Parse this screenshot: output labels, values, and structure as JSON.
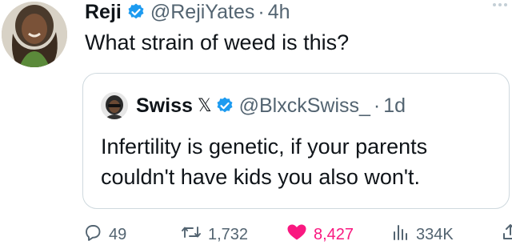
{
  "tweet": {
    "display_name": "Reji",
    "handle": "@RejiYates",
    "separator": "·",
    "time": "4h",
    "text": "What strain of weed is this?"
  },
  "quoted": {
    "display_name": "Swiss",
    "badge": "𝕏",
    "handle": "@BlxckSwiss_",
    "separator": "·",
    "time": "1d",
    "text_line1": "Infertility is genetic, if your parents",
    "text_line2": "couldn't have kids you also won't."
  },
  "actions": {
    "replies": "49",
    "retweets": "1,732",
    "likes": "8,427",
    "views": "334K"
  },
  "colors": {
    "verified": "#1d9bf0",
    "like": "#f91880",
    "secondary_text": "#536471",
    "border": "#cfd9de"
  },
  "icons": [
    "verified-badge-icon",
    "more-icon",
    "reply-icon",
    "retweet-icon",
    "heart-icon",
    "views-icon",
    "share-icon"
  ]
}
